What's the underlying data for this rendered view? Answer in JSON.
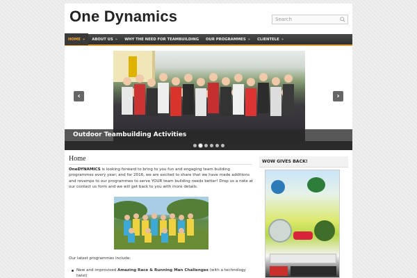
{
  "site": {
    "title": "One Dynamics"
  },
  "search": {
    "placeholder": "Search"
  },
  "nav": {
    "items": [
      {
        "label": "Home",
        "arrow": "»"
      },
      {
        "label": "About Us",
        "arrow": "»"
      },
      {
        "label": "Why the Need for Teambuilding",
        "arrow": ""
      },
      {
        "label": "Our Programmes",
        "arrow": "»"
      },
      {
        "label": "Clientele",
        "arrow": "»"
      }
    ]
  },
  "slider": {
    "caption": "Outdoor Teambuilding Activities",
    "prev": "‹",
    "next": "›",
    "dots": 6,
    "active_dot": 1
  },
  "main": {
    "title": "Home",
    "intro_bold": "OneDYNAMICS",
    "intro_text": " is looking forward to bring to you fun and engaging team building programmes every year; and for 2016, we are excited to share that we have made additions and revamps to our programmes to serve YOUR team building needs better! Drop us a note at our contact us form and we will get back to you with more details.",
    "latest": "Our latest programmes include:",
    "bullet_prefix": "New and improvised ",
    "bullet_bold": "Amazing Race & Running Man Challenges",
    "bullet_suffix": " (with a technology twist)"
  },
  "sidebar": {
    "title": "WOW GIVES BACK!"
  },
  "colors": {
    "nav_bg": "#3a3a3a",
    "accent": "#e39b2c",
    "active": "#f6a83b"
  }
}
